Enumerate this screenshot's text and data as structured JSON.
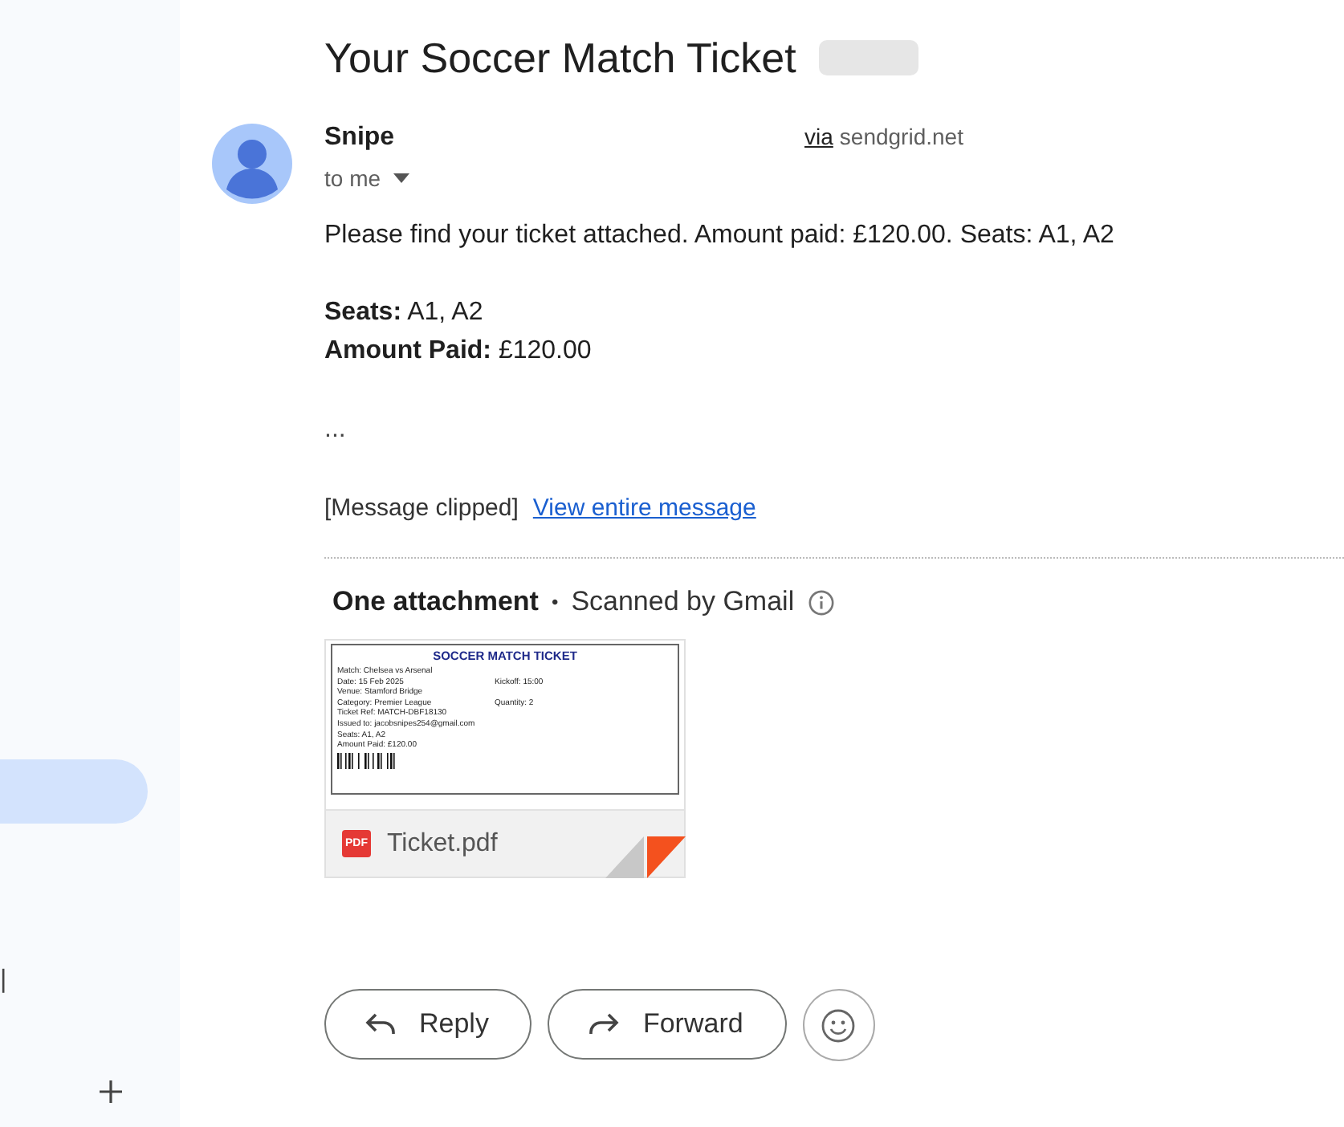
{
  "sidebar": {
    "text_fragment": "|"
  },
  "email": {
    "subject": "Your Soccer Match Ticket",
    "sender": "Snipe",
    "via_link": "via",
    "via_domain": "sendgrid.net",
    "recipient": "to me",
    "body": [
      {
        "kind": "text",
        "text": "Please find your ticket attached. Amount paid: £120.00. Seats: A1, A2"
      },
      {
        "kind": "field",
        "label": "Seats:",
        "value": "A1, A2"
      },
      {
        "kind": "field",
        "label": "Amount Paid:",
        "value": "£120.00"
      },
      {
        "kind": "ellipsis",
        "text": "..."
      }
    ],
    "clipped": "[Message clipped]",
    "view_link": "View entire message"
  },
  "attachments": {
    "title": "One attachment",
    "dot": "•",
    "scanned": "Scanned by Gmail",
    "file": {
      "badge": "PDF",
      "name": "Ticket.pdf",
      "preview": {
        "heading": "SOCCER MATCH TICKET",
        "lines": [
          {
            "left": "Match: Chelsea vs Arsenal"
          },
          {
            "left": "Date: 15 Feb 2025",
            "right": "Kickoff: 15:00"
          },
          {
            "left": "Venue: Stamford Bridge"
          },
          {
            "left": "Category: Premier League",
            "right": "Quantity: 2"
          },
          {
            "left": "Ticket Ref: MATCH-DBF18130"
          },
          {
            "left": "Issued to: jacobsnipes254@gmail.com"
          },
          {
            "left": "Seats: A1, A2"
          },
          {
            "left": "Amount Paid: £120.00"
          }
        ]
      }
    }
  },
  "actions": [
    {
      "kind": "reply",
      "label": "Reply"
    },
    {
      "kind": "forward",
      "label": "Forward"
    },
    {
      "kind": "emoji"
    }
  ]
}
